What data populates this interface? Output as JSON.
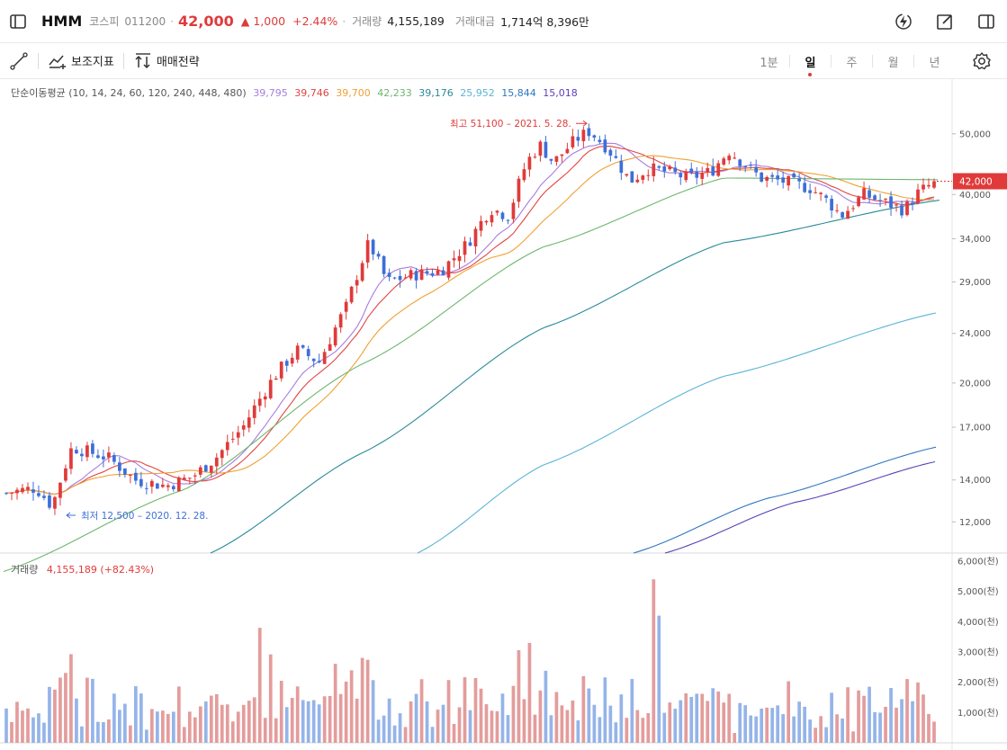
{
  "header": {
    "name": "HMM",
    "market": "코스피",
    "code": "011200",
    "price": "42,000",
    "change": "▲ 1,000",
    "change_pct": "+2.44%",
    "volume_label": "거래량",
    "volume": "4,155,189",
    "amount_label": "거래대금",
    "amount": "1,714억 8,396만"
  },
  "toolbar": {
    "indicator_label": "보조지표",
    "strategy_label": "매매전략",
    "periods": [
      "1분",
      "일",
      "주",
      "월",
      "년"
    ],
    "active_period": "일"
  },
  "colors": {
    "up": "#e03a3a",
    "down": "#3e6fd8",
    "vol_up": "#e49c9c",
    "vol_down": "#95b4e8"
  },
  "chart_data": {
    "type": "candlestick",
    "ma_title": "단순이동평균 (10, 14, 24, 60, 120, 240, 448, 480)",
    "ma_series": [
      {
        "period": 10,
        "value": "39,795",
        "color": "#a77de0"
      },
      {
        "period": 14,
        "value": "39,746",
        "color": "#e24444"
      },
      {
        "period": 24,
        "value": "39,700",
        "color": "#f0a030"
      },
      {
        "period": 60,
        "value": "42,233",
        "color": "#6db66d"
      },
      {
        "period": 120,
        "value": "39,176",
        "color": "#2a8a9a"
      },
      {
        "period": 240,
        "value": "25,952",
        "color": "#5bb4d6"
      },
      {
        "period": 448,
        "value": "15,844",
        "color": "#2e76c0"
      },
      {
        "period": 480,
        "value": "15,018",
        "color": "#5b3fb8"
      }
    ],
    "y_ticks": [
      "50,000",
      "40,000",
      "34,000",
      "29,000",
      "24,000",
      "20,000",
      "17,000",
      "14,000",
      "12,000"
    ],
    "y_scale": "log",
    "y_range": [
      10700,
      55000
    ],
    "current_price_label": "42,000",
    "current_price": 42000,
    "high_annotation": "최고 51,100 – 2021. 5. 28.",
    "low_annotation": "최저 12,500 – 2020. 12. 28.",
    "volume_label": "거래량",
    "volume_value": "4,155,189 (+82.43%)",
    "volume_ticks": [
      "6,000(천)",
      "5,000(천)",
      "4,000(천)",
      "3,000(천)",
      "2,000(천)",
      "1,000(천)"
    ],
    "volume_range": [
      0,
      6000
    ]
  }
}
